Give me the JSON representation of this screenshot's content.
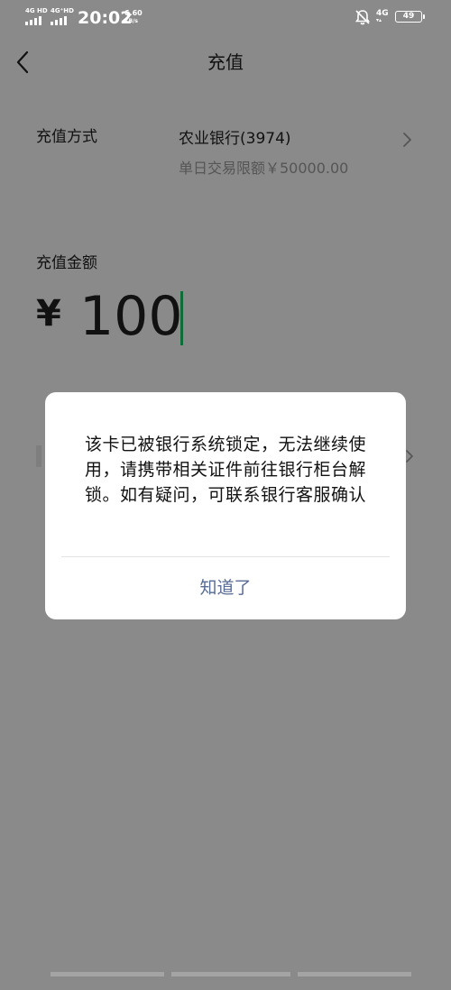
{
  "status_bar": {
    "network1": "4G HD",
    "network2": "4G⁺HD",
    "time": "20:02",
    "speed_value": "6.60",
    "speed_unit": "KB/s",
    "network_right": "4G",
    "network_right_arrows": "▾▴",
    "battery": "49"
  },
  "nav": {
    "title": "充值",
    "back_icon": "chevron-left-icon"
  },
  "payment_method": {
    "label": "充值方式",
    "bank": "农业银行(3974)",
    "limit": "单日交易限额￥50000.00",
    "chevron_icon": "chevron-right-icon"
  },
  "amount": {
    "label": "充值金额",
    "currency": "¥",
    "value": "100"
  },
  "dialog": {
    "message": "该卡已被银行系统锁定，无法继续使用，请携带相关证件前往银行柜台解锁。如有疑问，可联系银行客服确认",
    "button": "知道了"
  },
  "colors": {
    "overlay": "#8a8a8a",
    "dialog_bg": "#ffffff",
    "button_text": "#576b95",
    "cursor": "#0f6e37"
  }
}
